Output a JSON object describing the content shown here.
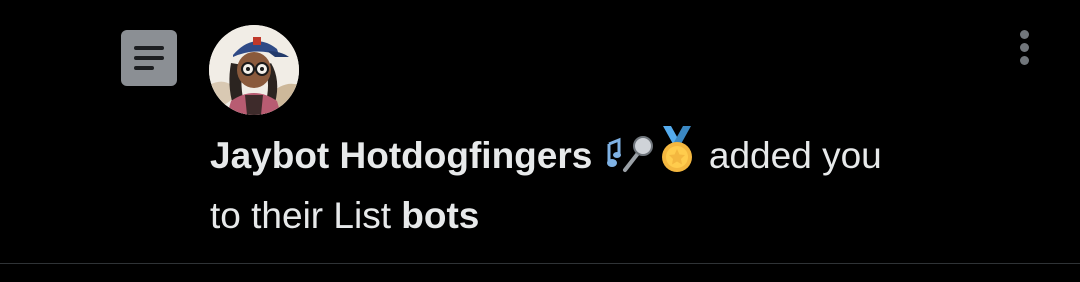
{
  "notification": {
    "user_name": "Jaybot Hotdogfingers",
    "name_emojis": [
      "microphone-notes-emoji",
      "medal-emoji"
    ],
    "action_text": " added you",
    "line2_prefix": "to their List ",
    "list_name": "bots"
  },
  "icons": {
    "list": "list-icon",
    "more": "more-vertical-icon"
  },
  "colors": {
    "background": "#000000",
    "text": "#e7e9ea",
    "list_icon_bg": "#8b8f94",
    "muted": "#71767b",
    "divider": "#2f3336"
  }
}
